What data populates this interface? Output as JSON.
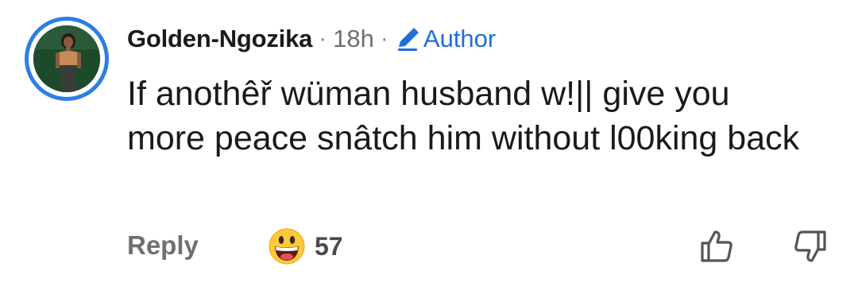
{
  "comment": {
    "username": "Golden-Ngozika",
    "separator": "·",
    "time": "18h",
    "author_label": "Author",
    "text": "If anothêř wüman husband w!|| give you more peace snâtch him without l00king back"
  },
  "actions": {
    "reply_label": "Reply",
    "reaction_emoji": "grinning-face-with-big-eyes",
    "reaction_count": "57"
  },
  "icons": {
    "author_badge": "pencil-icon",
    "like": "thumbs-up-icon",
    "dislike": "thumbs-down-icon"
  },
  "colors": {
    "avatar_ring": "#2d7ee6",
    "author_accent": "#1f6fd6",
    "muted_text": "#707070",
    "emoji_yellow": "#ffc83d"
  }
}
